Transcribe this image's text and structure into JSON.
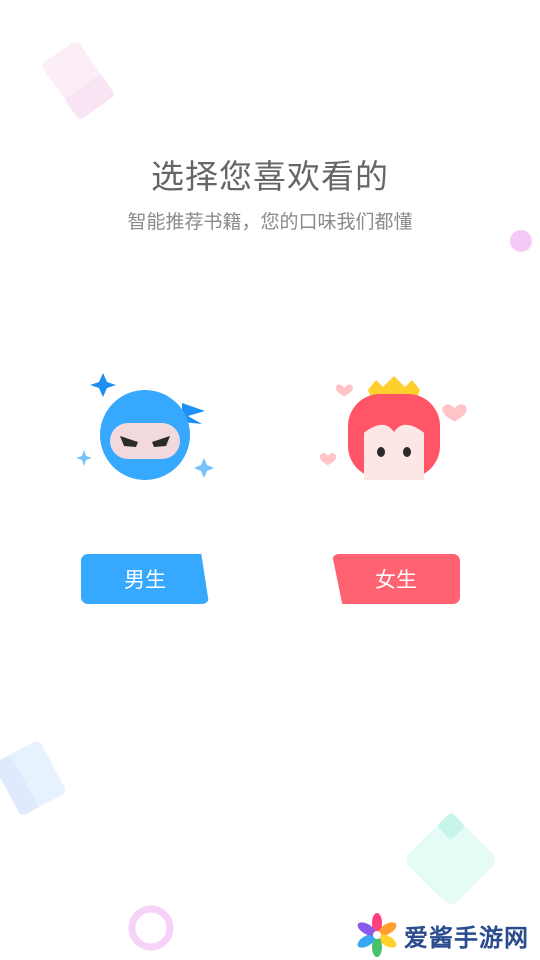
{
  "title": "选择您喜欢看的",
  "subtitle": "智能推荐书籍，您的口味我们都懂",
  "options": {
    "male": {
      "label": "男生",
      "color": "#36a9ff"
    },
    "female": {
      "label": "女生",
      "color": "#ff6270"
    }
  },
  "watermark": {
    "text": "爱酱手游网"
  }
}
